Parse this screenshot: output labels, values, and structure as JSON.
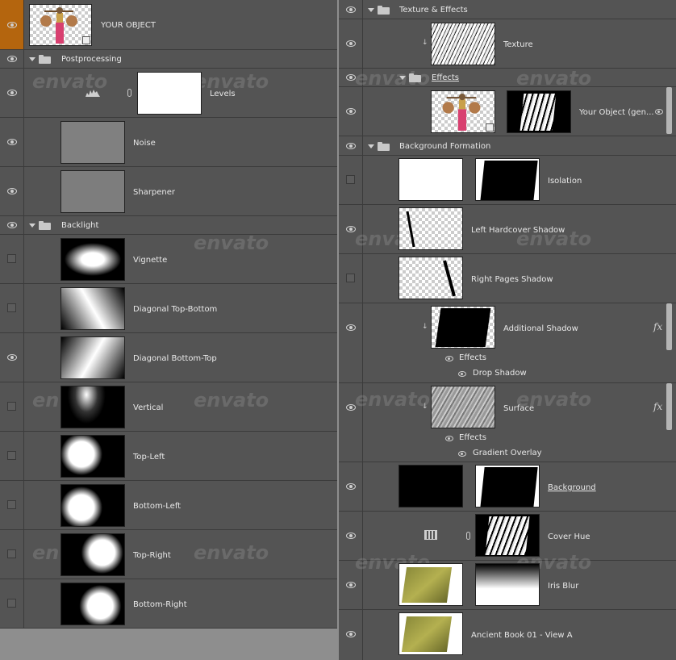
{
  "watermark": "envato",
  "left": {
    "your_object": "YOUR OBJECT",
    "postprocessing": "Postprocessing",
    "levels": "Levels",
    "noise": "Noise",
    "sharpener": "Sharpener",
    "backlight": "Backlight",
    "vignette": "Vignette",
    "diag_tb": "Diagonal Top-Bottom",
    "diag_bt": "Diagonal Bottom-Top",
    "vertical": "Vertical",
    "top_left": "Top-Left",
    "bottom_left": "Bottom-Left",
    "top_right": "Top-Right",
    "bottom_right": "Bottom-Right"
  },
  "right": {
    "texture_effects": "Texture & Effects",
    "texture": "Texture",
    "effects_group": "Effects",
    "your_object_gen": "Your Object (gen...",
    "background_formation": "Background Formation",
    "isolation": "Isolation",
    "left_hardcover": "Left Hardcover Shadow",
    "right_pages": "Right Pages Shadow",
    "additional_shadow": "Additional Shadow",
    "effects_1": "Effects",
    "drop_shadow": "Drop Shadow",
    "surface": "Surface",
    "effects_2": "Effects",
    "gradient_overlay": "Gradient Overlay",
    "background": "Background",
    "cover_hue": "Cover Hue",
    "iris_blur": "Iris Blur",
    "ancient_book": "Ancient Book 01 - View A"
  },
  "fx_label": "fx",
  "colors": {
    "panel_bg": "#545454",
    "selected_eye": "#b4650e",
    "divider": "#3b3b3b"
  }
}
